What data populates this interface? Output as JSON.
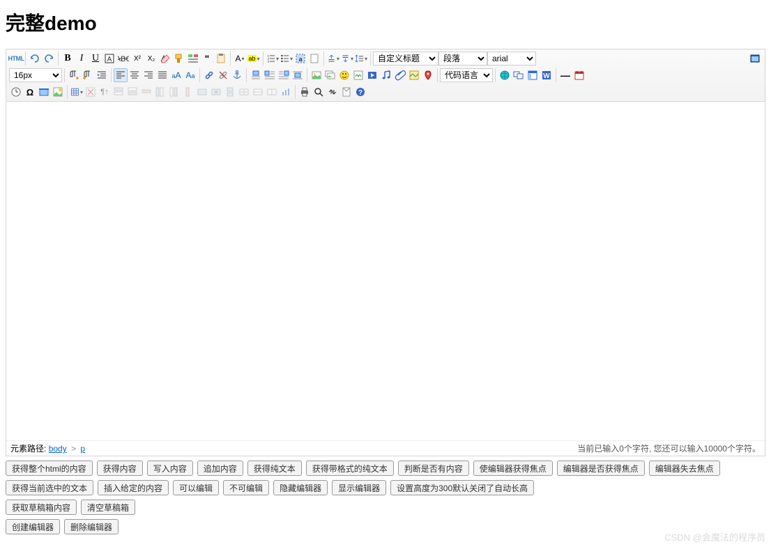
{
  "title": "完整demo",
  "toolbar": {
    "html": "HTML",
    "fontsize_value": "16px",
    "custom_heading": "自定义标题",
    "paragraph": "段落",
    "fontfamily": "arial",
    "codelang": "代码语言"
  },
  "status": {
    "path_label": "元素路径:",
    "crumb_body": "body",
    "crumb_p": "p",
    "gt": ">",
    "counter_prefix": "当前已输入",
    "counter_typed": "0",
    "counter_mid": "个字符, 您还可以输入",
    "counter_remain": "10000",
    "counter_suffix": "个字符。"
  },
  "buttons_row1": [
    "获得整个html的内容",
    "获得内容",
    "写入内容",
    "追加内容",
    "获得纯文本",
    "获得带格式的纯文本",
    "判断是否有内容",
    "使编辑器获得焦点",
    "编辑器是否获得焦点",
    "编辑器失去焦点"
  ],
  "buttons_row2": [
    "获得当前选中的文本",
    "插入给定的内容",
    "可以编辑",
    "不可编辑",
    "隐藏编辑器",
    "显示编辑器",
    "设置高度为300默认关闭了自动长高"
  ],
  "buttons_row3": [
    "获取草稿箱内容",
    "清空草稿箱"
  ],
  "buttons_row4": [
    "创建编辑器",
    "删除编辑器"
  ],
  "watermark": "CSDN @会魔法的程序员"
}
